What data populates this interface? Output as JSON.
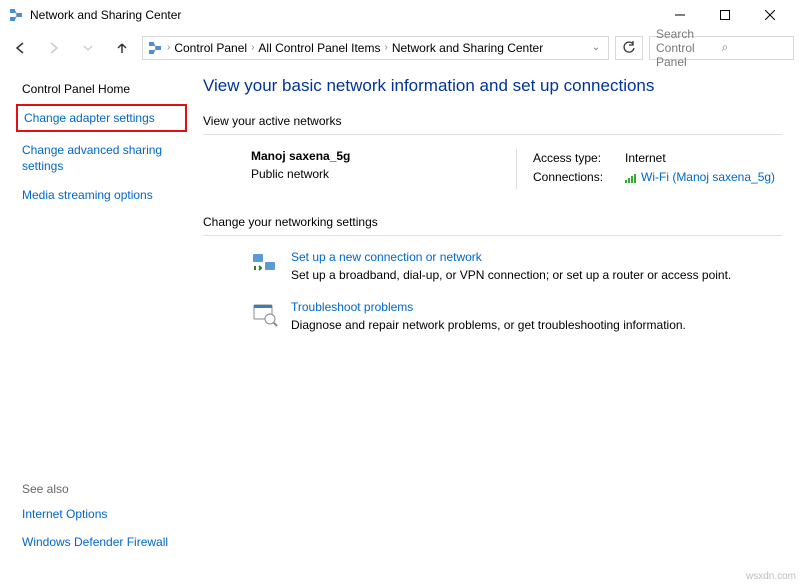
{
  "titlebar": {
    "title": "Network and Sharing Center"
  },
  "breadcrumb": {
    "items": [
      "Control Panel",
      "All Control Panel Items",
      "Network and Sharing Center"
    ]
  },
  "search": {
    "placeholder": "Search Control Panel"
  },
  "sidebar": {
    "home": "Control Panel Home",
    "adapter": "Change adapter settings",
    "advanced": "Change advanced sharing settings",
    "streaming": "Media streaming options",
    "seealso_label": "See also",
    "seealso1": "Internet Options",
    "seealso2": "Windows Defender Firewall"
  },
  "main": {
    "title": "View your basic network information and set up connections",
    "active_label": "View your active networks",
    "net_name": "Manoj saxena_5g",
    "net_type": "Public network",
    "access_key": "Access type:",
    "access_val": "Internet",
    "conn_key": "Connections:",
    "conn_val": "Wi-Fi (Manoj saxena_5g)",
    "change_label": "Change your networking settings",
    "setup_title": "Set up a new connection or network",
    "setup_desc": "Set up a broadband, dial-up, or VPN connection; or set up a router or access point.",
    "trouble_title": "Troubleshoot problems",
    "trouble_desc": "Diagnose and repair network problems, or get troubleshooting information."
  },
  "watermark": "wsxdn.com"
}
